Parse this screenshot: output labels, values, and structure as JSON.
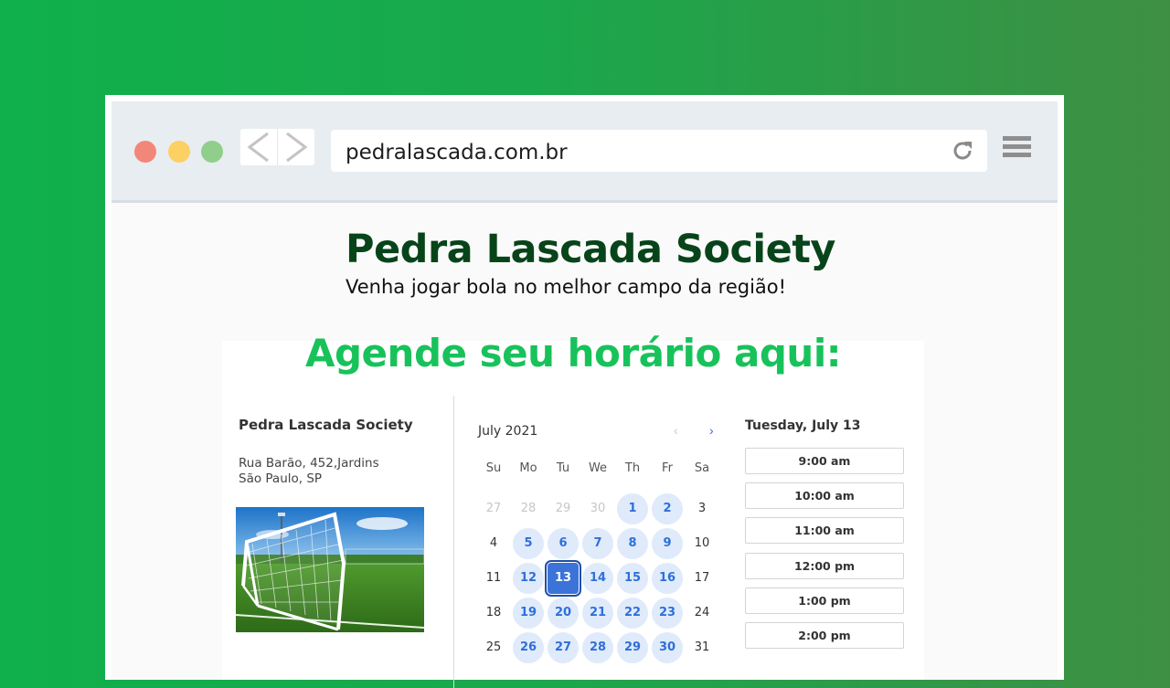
{
  "browser": {
    "url": "pedralascada.com.br"
  },
  "site": {
    "title": "Pedra Lascada Society",
    "subtitle": "Venha jogar bola no melhor campo da região!",
    "cta": "Agende seu horário aqui:"
  },
  "booking": {
    "business_name": "Pedra Lascada Society",
    "address_line1": "Rua Barão, 452,Jardins",
    "address_line2": "São Paulo, SP",
    "month_label": "July 2021",
    "prev_glyph": "‹",
    "next_glyph": "›",
    "weekdays": [
      "Su",
      "Mo",
      "Tu",
      "We",
      "Th",
      "Fr",
      "Sa"
    ],
    "weeks": [
      [
        {
          "d": "27",
          "s": "muted"
        },
        {
          "d": "28",
          "s": "muted"
        },
        {
          "d": "29",
          "s": "muted"
        },
        {
          "d": "30",
          "s": "muted"
        },
        {
          "d": "1",
          "s": "avail"
        },
        {
          "d": "2",
          "s": "avail"
        },
        {
          "d": "3",
          "s": "plain"
        }
      ],
      [
        {
          "d": "4",
          "s": "plain"
        },
        {
          "d": "5",
          "s": "avail"
        },
        {
          "d": "6",
          "s": "avail"
        },
        {
          "d": "7",
          "s": "avail"
        },
        {
          "d": "8",
          "s": "avail"
        },
        {
          "d": "9",
          "s": "avail"
        },
        {
          "d": "10",
          "s": "plain"
        }
      ],
      [
        {
          "d": "11",
          "s": "plain"
        },
        {
          "d": "12",
          "s": "avail"
        },
        {
          "d": "13",
          "s": "selected"
        },
        {
          "d": "14",
          "s": "avail"
        },
        {
          "d": "15",
          "s": "avail"
        },
        {
          "d": "16",
          "s": "avail"
        },
        {
          "d": "17",
          "s": "plain"
        }
      ],
      [
        {
          "d": "18",
          "s": "plain"
        },
        {
          "d": "19",
          "s": "avail"
        },
        {
          "d": "20",
          "s": "avail"
        },
        {
          "d": "21",
          "s": "avail"
        },
        {
          "d": "22",
          "s": "avail"
        },
        {
          "d": "23",
          "s": "avail"
        },
        {
          "d": "24",
          "s": "plain"
        }
      ],
      [
        {
          "d": "25",
          "s": "plain"
        },
        {
          "d": "26",
          "s": "avail"
        },
        {
          "d": "27",
          "s": "avail"
        },
        {
          "d": "28",
          "s": "avail"
        },
        {
          "d": "29",
          "s": "avail"
        },
        {
          "d": "30",
          "s": "avail"
        },
        {
          "d": "31",
          "s": "plain"
        }
      ]
    ],
    "selected_date_label": "Tuesday, July 13",
    "time_slots": [
      "9:00 am",
      "10:00 am",
      "11:00 am",
      "12:00 pm",
      "1:00 pm",
      "2:00 pm"
    ]
  },
  "colors": {
    "brand_dark": "#08441a",
    "brand_accent": "#18c25b",
    "calendar_blue": "#2f6fd8"
  }
}
